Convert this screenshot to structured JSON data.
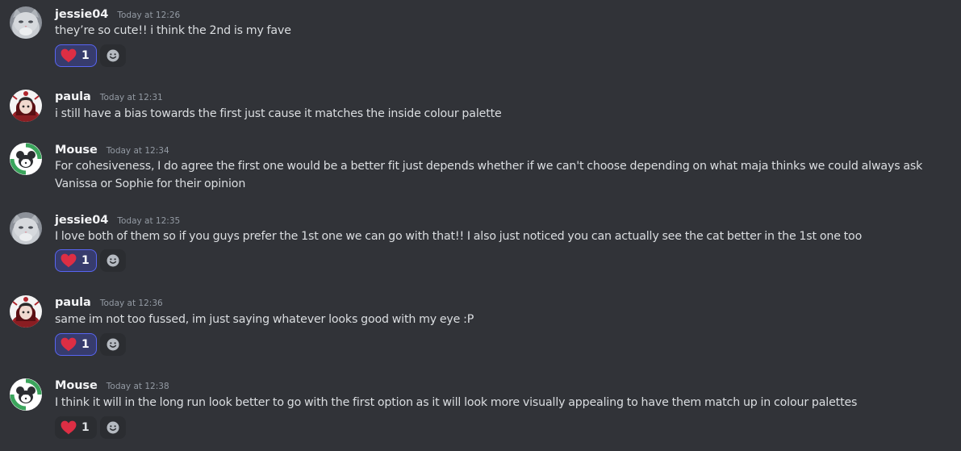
{
  "messages": [
    {
      "author": "jessie04",
      "avatar": "cat-avatar",
      "timestamp": "Today at 12:26",
      "text": "they’re so cute!! i think the 2nd is my fave",
      "reaction": {
        "emoji": "heart-icon",
        "count": "1",
        "me": true
      }
    },
    {
      "author": "paula",
      "avatar": "character-avatar",
      "timestamp": "Today at 12:31",
      "text": "i still have a bias towards the first just cause it matches the inside colour palette"
    },
    {
      "author": "Mouse",
      "avatar": "mouse-avatar",
      "timestamp": "Today at 12:34",
      "text": "For cohesiveness, I do agree the first one would be a better fit just depends whether if we can't choose depending on what maja thinks we could always ask Vanissa or Sophie for their opinion"
    },
    {
      "author": "jessie04",
      "avatar": "cat-avatar",
      "timestamp": "Today at 12:35",
      "text": "I love both of them so if you guys prefer the 1st one we can go with that!! I also just noticed you can actually see the cat better in the 1st one too",
      "reaction": {
        "emoji": "heart-icon",
        "count": "1",
        "me": true
      }
    },
    {
      "author": "paula",
      "avatar": "character-avatar",
      "timestamp": "Today at 12:36",
      "text": "same im not too fussed, im just saying whatever looks good with my eye :P",
      "reaction": {
        "emoji": "heart-icon",
        "count": "1",
        "me": true
      }
    },
    {
      "author": "Mouse",
      "avatar": "mouse-avatar",
      "timestamp": "Today at 12:38",
      "text": "I think it will in the long run look better to go with the first option as it will look more visually appealing to have them match up in colour palettes",
      "reaction": {
        "emoji": "heart-icon",
        "count": "1",
        "me": false
      }
    }
  ],
  "colors": {
    "background": "#313338",
    "reaction_selected_bg": "#373c6d",
    "reaction_selected_border": "#5865f2",
    "reaction_bg": "#2b2d31",
    "heart": "#dd2e44",
    "timestamp": "#949ba4",
    "username": "#f2f3f5",
    "text": "#dbdee1"
  },
  "icons": {
    "add_reaction": "smiley-plus-icon",
    "heart": "heart-icon"
  }
}
